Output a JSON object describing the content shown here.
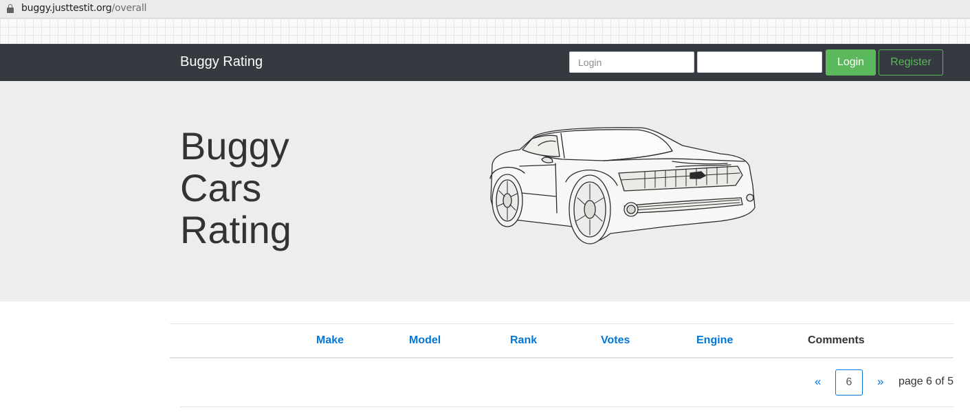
{
  "browser": {
    "url_host": "buggy.justtestit.org",
    "url_path": "/overall"
  },
  "navbar": {
    "brand": "Buggy Rating",
    "login_placeholder": "Login",
    "login_button": "Login",
    "register_button": "Register"
  },
  "hero": {
    "title_line1": "Buggy",
    "title_line2": "Cars",
    "title_line3": "Rating"
  },
  "table": {
    "columns": [
      {
        "label": "Make"
      },
      {
        "label": "Model"
      },
      {
        "label": "Rank"
      },
      {
        "label": "Votes"
      },
      {
        "label": "Engine"
      },
      {
        "label": "Comments"
      }
    ]
  },
  "pagination": {
    "prev": "«",
    "next": "»",
    "current_page": "6",
    "label": "page 6 of 5"
  },
  "colors": {
    "navbar_bg": "#343a40",
    "accent_green": "#5cb85c",
    "link_blue": "#0275d8",
    "jumbotron_bg": "#ecedee"
  }
}
